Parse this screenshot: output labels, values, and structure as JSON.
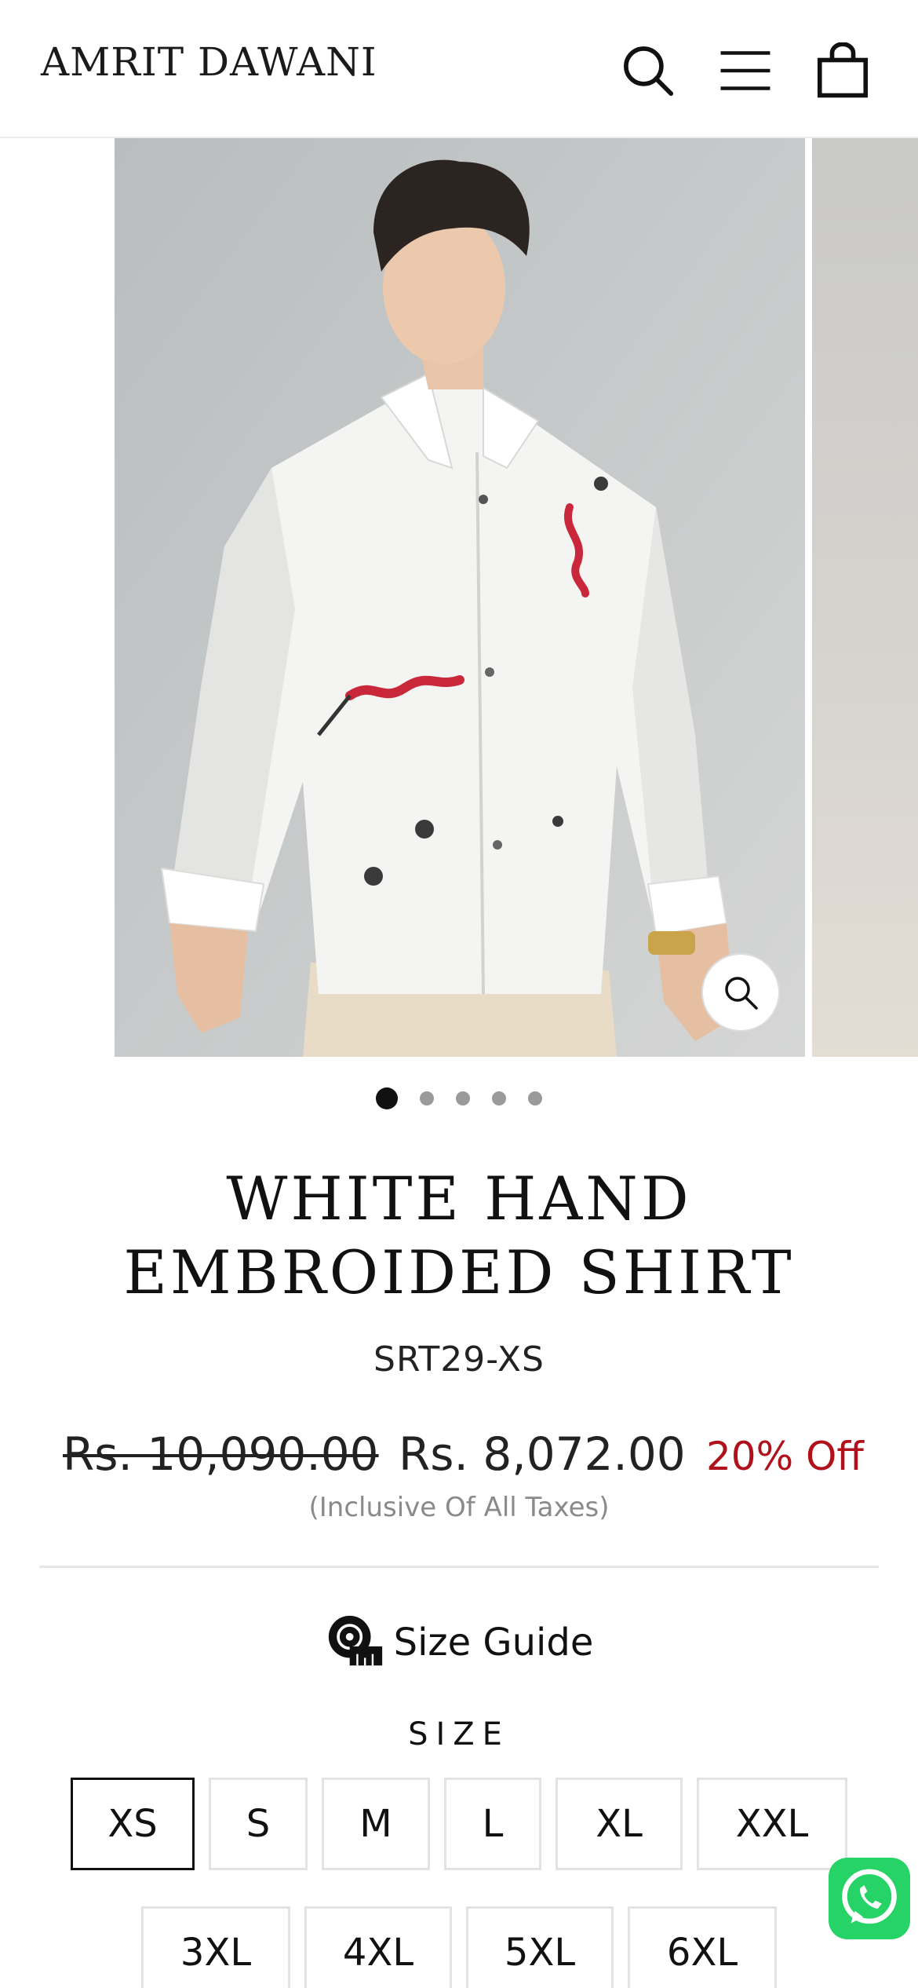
{
  "header": {
    "brand": "AMRIT DAWANI",
    "icons": [
      "search-icon",
      "menu-icon",
      "cart-icon"
    ]
  },
  "gallery": {
    "slide_count": 5,
    "active_slide": 1,
    "zoom_icon": "zoom-icon"
  },
  "product": {
    "title": "WHITE HAND EMBROIDED SHIRT",
    "sku": "SRT29-XS",
    "price_original": "Rs. 10,090.00",
    "price_sale": "Rs. 8,072.00",
    "discount": "20% Off",
    "tax_note": "(Inclusive Of All Taxes)"
  },
  "size_guide": {
    "label": "Size Guide",
    "icon": "measuring-tape-icon"
  },
  "sizes": {
    "label": "SIZE",
    "selected": "XS",
    "options": [
      "XS",
      "S",
      "M",
      "L",
      "XL",
      "XXL",
      "3XL",
      "4XL",
      "5XL",
      "6XL"
    ]
  },
  "colors": {
    "sale_red": "#b0121b",
    "whatsapp_green": "#25d366",
    "text": "#111111"
  }
}
